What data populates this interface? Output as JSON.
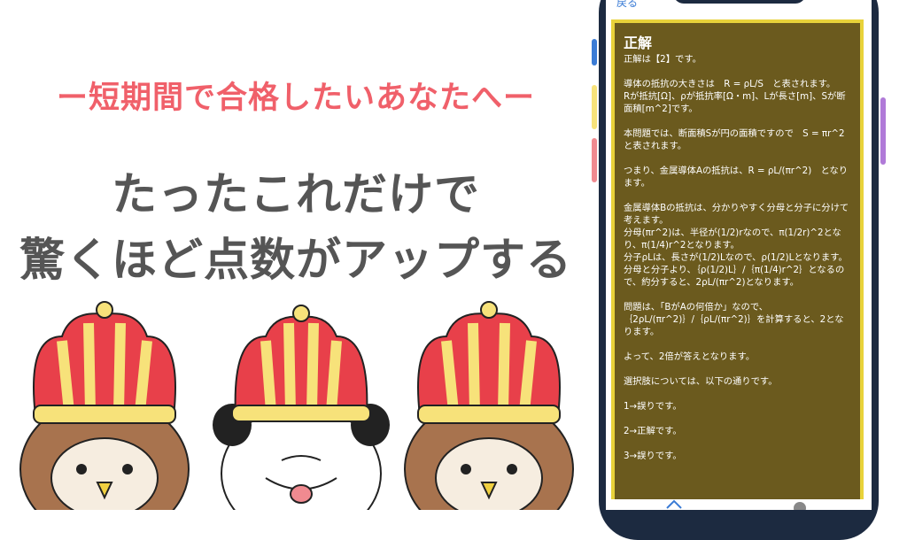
{
  "banner": {
    "tagline": "ー短期間で合格したいあなたへー",
    "headline_line1": "たったこれだけで",
    "headline_line2": "驚くほど点数がアップする"
  },
  "phone": {
    "back_label": "戻る",
    "answer": {
      "title": "正解",
      "paragraphs": [
        [
          "正解は【2】です。"
        ],
        [
          "導体の抵抗の大きさは　R = ρL/S　と表されます。",
          "Rが抵抗[Ω]、ρが抵抗率[Ω・m]、Lが長さ[m]、Sが断面積[m^2]です。"
        ],
        [
          "本問題では、断面積Sが円の面積ですので　S = πr^2　と表されます。"
        ],
        [
          "つまり、金属導体Aの抵抗は、R = ρL/(πr^2)　となります。"
        ],
        [
          "金属導体Bの抵抗は、分かりやすく分母と分子に分けて考えます。",
          "分母(πr^2)は、半径が(1/2)rなので、π(1/2r)^2となり、π(1/4)r^2となります。",
          "分子ρLは、長さが(1/2)Lなので、ρ(1/2)Lとなります。",
          "分母と分子より、｛ρ(1/2)L｝/｛π(1/4)r^2｝となるので、約分すると、2ρL/(πr^2)となります。"
        ],
        [
          "問題は、「BがAの何倍か」なので、",
          "｛2ρL/(πr^2)｝/｛ρL/(πr^2)｝を計算すると、2となります。"
        ],
        [
          "よって、2倍が答えとなります。"
        ],
        [
          "選択肢については、以下の通りです。"
        ],
        [
          "1→誤りです。"
        ],
        [
          "2→正解です。"
        ],
        [
          "3→誤りです。"
        ]
      ]
    }
  },
  "colors": {
    "tagline": "#f0606a",
    "headline": "#555555",
    "answer_bg": "#6b5a1e",
    "answer_border": "#e8d23a",
    "phone_frame": "#1c2a40",
    "crown_red": "#e8404a",
    "crown_yellow": "#f7e27a",
    "owl_brown": "#a8734e"
  },
  "characters": [
    {
      "name": "owl-king"
    },
    {
      "name": "panda-king"
    },
    {
      "name": "owl-king"
    }
  ]
}
